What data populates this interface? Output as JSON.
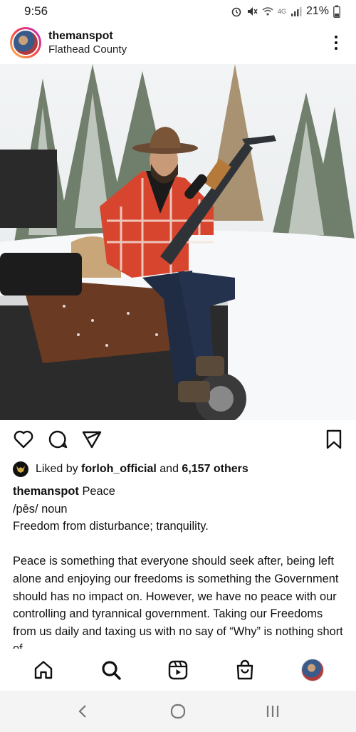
{
  "status_bar": {
    "time": "9:56",
    "battery_percent": "21%",
    "network": "4G"
  },
  "post": {
    "username": "themanspot",
    "location": "Flathead County",
    "liked_by_prefix": "Liked by ",
    "liked_by_user": "forloh_official",
    "liked_by_middle": " and ",
    "liked_by_count": "6,157 others",
    "caption_user": "themanspot",
    "caption_lines": [
      "Peace",
      "/pēs/ noun",
      "Freedom from disturbance; tranquility.",
      "",
      "Peace is something that everyone should seek after, being left alone and enjoying our freedoms is something the Government should has no impact on. However, we have no peace with our controlling and tyrannical government.  Taking our Freedoms from us daily and taxing us with no say of “Why” is nothing short of"
    ]
  },
  "icons": {
    "like": "heart-icon",
    "comment": "comment-icon",
    "share": "send-icon",
    "save": "bookmark-icon",
    "home": "home-icon",
    "search": "search-icon",
    "reels": "reels-icon",
    "shop": "shop-icon",
    "profile": "profile-avatar",
    "back": "back-icon",
    "home_sys": "home-circle-icon",
    "recents": "recents-icon"
  },
  "colors": {
    "text": "#111111",
    "background": "#ffffff",
    "story_ring_start": "#f9c74f",
    "story_ring_end": "#c026d3"
  }
}
